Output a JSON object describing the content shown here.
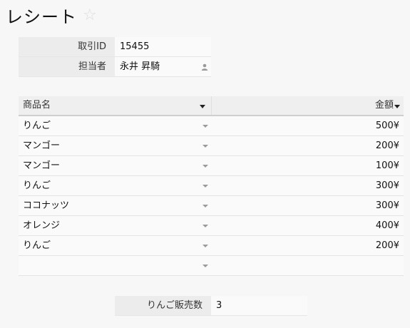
{
  "page": {
    "title": "レシート",
    "favorite_icon": "star-outline-icon"
  },
  "info": {
    "transaction_id_label": "取引ID",
    "transaction_id_value": "15455",
    "staff_label": "担当者",
    "staff_value": "永井 昇騎",
    "staff_icon": "person-icon"
  },
  "table": {
    "columns": [
      "商品名",
      "金額"
    ],
    "rows": [
      {
        "product": "りんご",
        "amount": "500¥"
      },
      {
        "product": "マンゴー",
        "amount": "200¥"
      },
      {
        "product": "マンゴー",
        "amount": "100¥"
      },
      {
        "product": "りんご",
        "amount": "300¥"
      },
      {
        "product": "ココナッツ",
        "amount": "300¥"
      },
      {
        "product": "オレンジ",
        "amount": "400¥"
      },
      {
        "product": "りんご",
        "amount": "200¥"
      },
      {
        "product": "",
        "amount": ""
      }
    ]
  },
  "summary": {
    "label": "りんご販売数",
    "value": "3"
  }
}
